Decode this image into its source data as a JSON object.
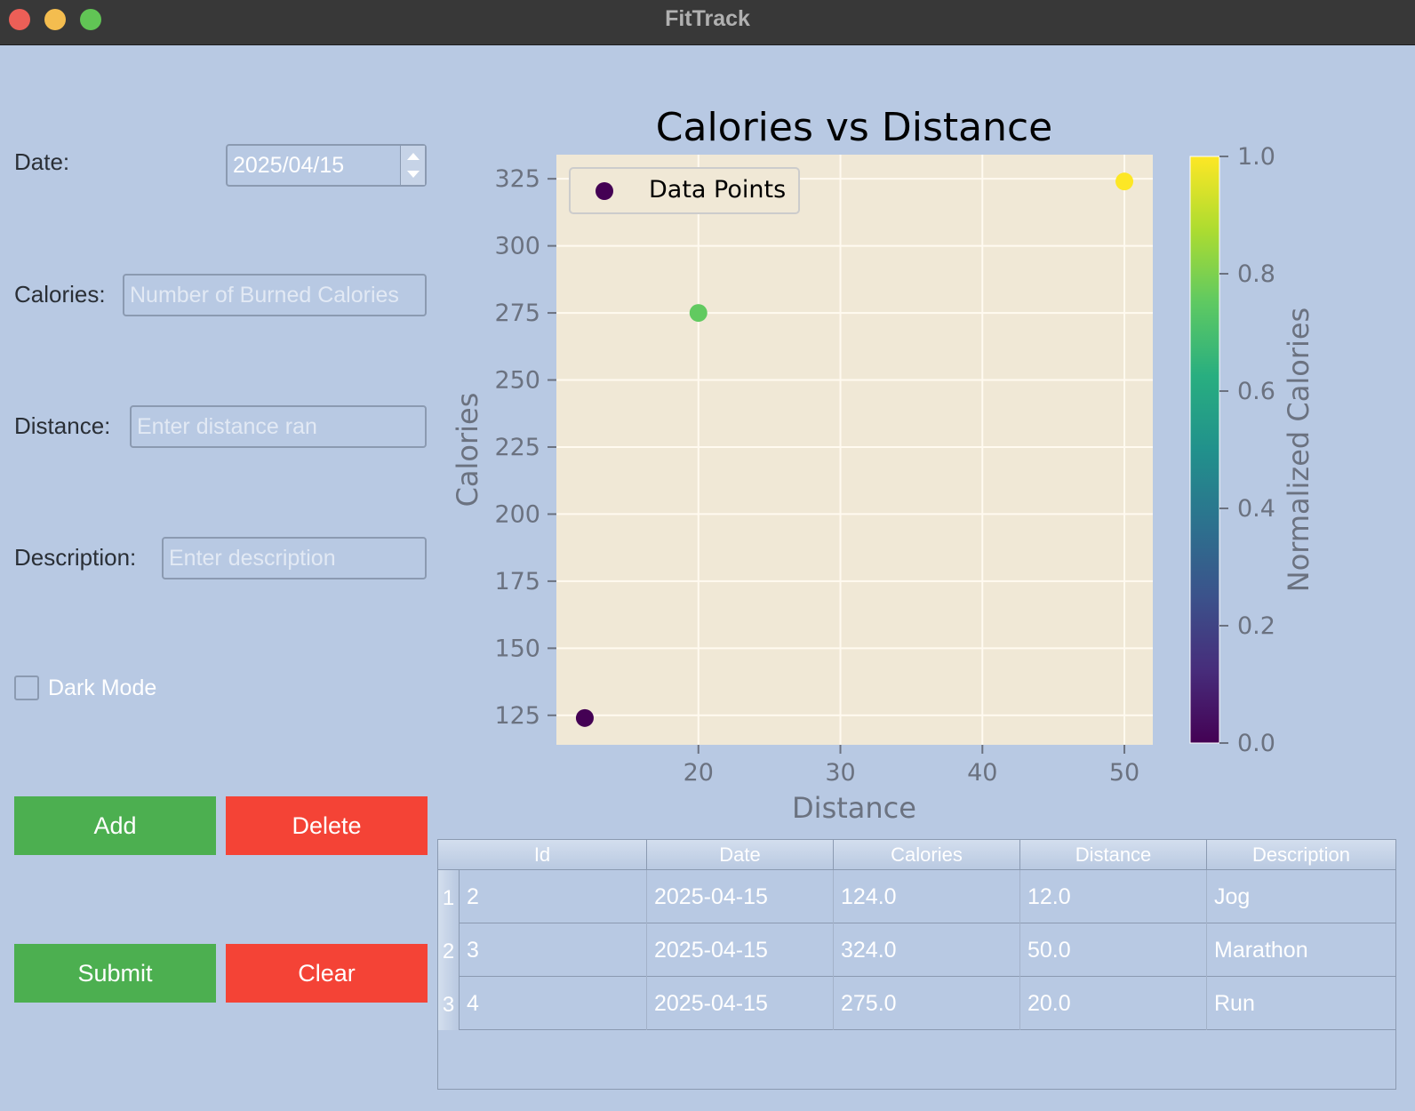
{
  "window": {
    "title": "FitTrack"
  },
  "form": {
    "date_label": "Date:",
    "date_value": "2025/04/15",
    "calories_label": "Calories:",
    "calories_placeholder": "Number of Burned Calories",
    "distance_label": "Distance:",
    "distance_placeholder": "Enter distance ran",
    "description_label": "Description:",
    "description_placeholder": "Enter description",
    "dark_mode_label": "Dark Mode",
    "dark_mode_checked": false
  },
  "buttons": {
    "add": "Add",
    "delete": "Delete",
    "submit": "Submit",
    "clear": "Clear"
  },
  "colors": {
    "green_button": "#4caf50",
    "red_button": "#f44336",
    "background": "#b8c9e3",
    "plot_background": "#f0e8d6"
  },
  "chart_data": {
    "type": "scatter",
    "title": "Calories vs Distance",
    "xlabel": "Distance",
    "ylabel": "Calories",
    "xlim": [
      10,
      52
    ],
    "ylim": [
      114,
      334
    ],
    "xticks": [
      20,
      30,
      40,
      50
    ],
    "yticks": [
      125,
      150,
      175,
      200,
      225,
      250,
      275,
      300,
      325
    ],
    "grid": true,
    "legend": {
      "placement": "upper-left",
      "entries": [
        "Data Points"
      ]
    },
    "colormap": "viridis",
    "colorbar": {
      "label": "Normalized Calories",
      "ticks": [
        "0.0",
        "0.2",
        "0.4",
        "0.6",
        "0.8",
        "1.0"
      ]
    },
    "points": [
      {
        "x": 12.0,
        "y": 124.0,
        "c": 0.0
      },
      {
        "x": 20.0,
        "y": 275.0,
        "c": 0.755
      },
      {
        "x": 50.0,
        "y": 324.0,
        "c": 1.0
      }
    ]
  },
  "table": {
    "columns": [
      "Id",
      "Date",
      "Calories",
      "Distance",
      "Description"
    ],
    "rows": [
      {
        "num": "1",
        "cells": [
          "2",
          "2025-04-15",
          "124.0",
          "12.0",
          "Jog"
        ]
      },
      {
        "num": "2",
        "cells": [
          "3",
          "2025-04-15",
          "324.0",
          "50.0",
          "Marathon"
        ]
      },
      {
        "num": "3",
        "cells": [
          "4",
          "2025-04-15",
          "275.0",
          "20.0",
          "Run"
        ]
      }
    ]
  }
}
